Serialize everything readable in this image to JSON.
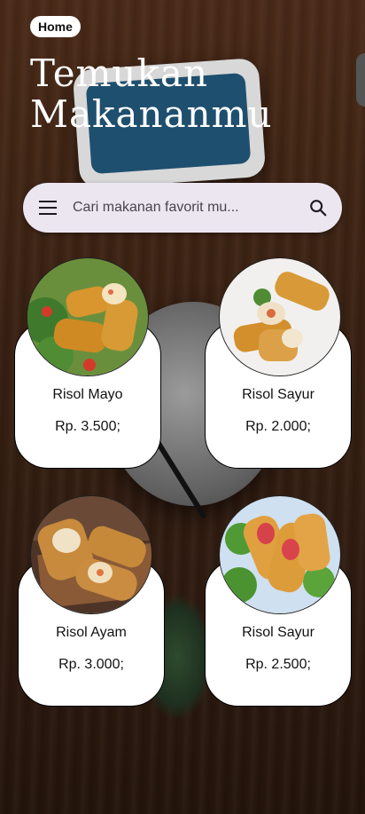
{
  "header": {
    "home_label": "Home",
    "title": "Temukan Makananmu"
  },
  "search": {
    "placeholder": "Cari makanan favorit mu...",
    "menu_icon": "menu-icon",
    "search_icon": "search-icon"
  },
  "products": [
    {
      "name": "Risol Mayo",
      "price": "Rp. 3.500;"
    },
    {
      "name": "Risol Sayur",
      "price": "Rp. 2.000;"
    },
    {
      "name": "Risol Ayam",
      "price": "Rp. 3.000;"
    },
    {
      "name": "Risol Sayur",
      "price": "Rp. 2.500;"
    }
  ],
  "colors": {
    "search_bg": "#ece6f0",
    "card_bg": "#ffffff",
    "title_text": "#ffffff"
  }
}
